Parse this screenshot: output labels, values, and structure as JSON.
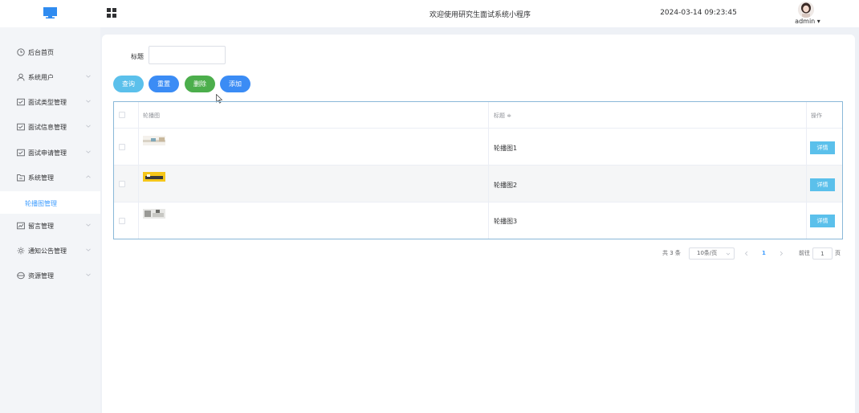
{
  "header": {
    "title": "欢迎使用研究生面试系统小程序",
    "datetime": "2024-03-14 09:23:45",
    "user": "admin"
  },
  "sidebar": {
    "items": [
      {
        "label": "后台首页",
        "icon": "clock-icon"
      },
      {
        "label": "系统用户",
        "icon": "user-icon"
      },
      {
        "label": "面试类型管理",
        "icon": "form-icon"
      },
      {
        "label": "面试信息管理",
        "icon": "form-icon"
      },
      {
        "label": "面试申请管理",
        "icon": "form-icon"
      },
      {
        "label": "系统管理",
        "icon": "folder-icon"
      },
      {
        "label": "留言管理",
        "icon": "chart-icon"
      },
      {
        "label": "通知公告管理",
        "icon": "sun-icon"
      },
      {
        "label": "资源管理",
        "icon": "disk-icon"
      }
    ],
    "sub_item": "轮播图管理"
  },
  "search": {
    "label": "标题",
    "value": ""
  },
  "buttons": {
    "query": "查询",
    "reset": "重置",
    "delete": "删除",
    "add": "添加"
  },
  "table": {
    "headers": {
      "image": "轮播图",
      "title": "标题 ≑",
      "op": "操作"
    },
    "rows": [
      {
        "title": "轮播图1",
        "action": "详情"
      },
      {
        "title": "轮播图2",
        "action": "详情"
      },
      {
        "title": "轮播图3",
        "action": "详情"
      }
    ]
  },
  "pagination": {
    "total": "共 3 条",
    "page_size": "10条/页",
    "current": "1",
    "goto_label": "前往",
    "goto_value": "1",
    "page_suffix": "页"
  },
  "colors": {
    "accent": "#409eff",
    "query": "#5bc0eb",
    "reset": "#3b8cf5",
    "delete": "#4cae4c",
    "add": "#3b8cf5"
  }
}
